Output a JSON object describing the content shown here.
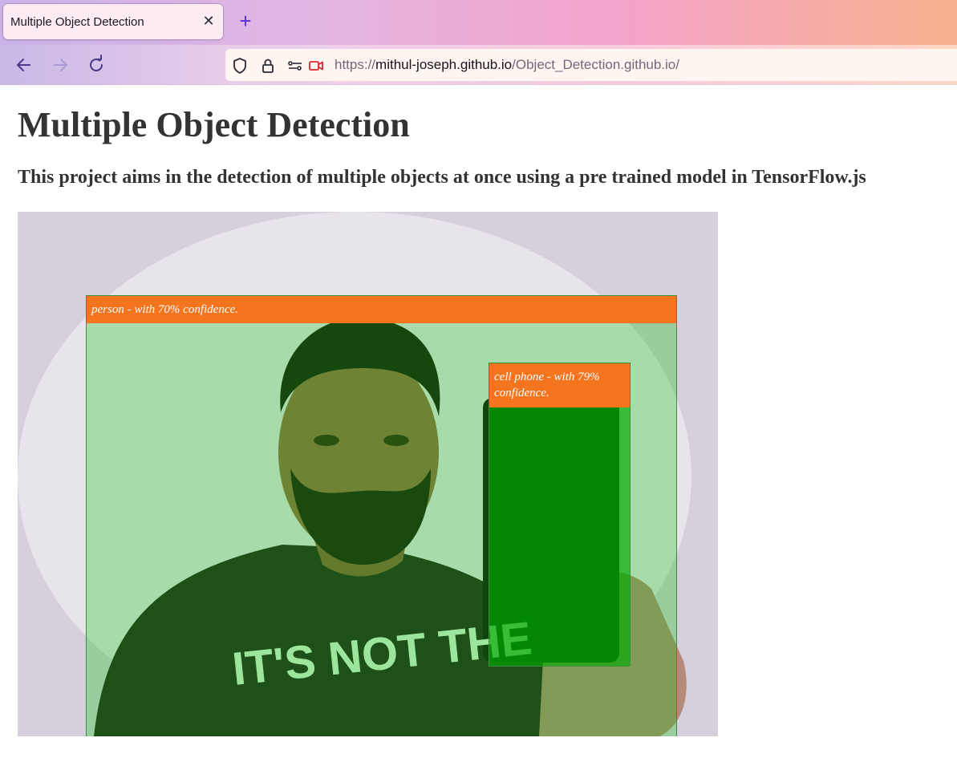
{
  "browser": {
    "tab_title": "Multiple Object Detection",
    "tab_close_icon": "close-icon",
    "new_tab_icon": "plus-icon",
    "back_icon": "arrow-left-icon",
    "forward_icon": "arrow-right-icon",
    "reload_icon": "reload-icon",
    "url_scheme": "https://",
    "url_host": "mithul-joseph.github.io",
    "url_path": "/Object_Detection.github.io/",
    "accent_color": "#5b2bd6"
  },
  "page": {
    "title": "Multiple Object Detection",
    "subtitle": "This project aims in the detection of multiple objects at once using a pre trained model in TensorFlow.js"
  },
  "detections": [
    {
      "label": "person - with 70% confidence.",
      "class": "person",
      "confidence": 70
    },
    {
      "label": "cell phone - with 79% confidence.",
      "class": "cell phone",
      "confidence": 79
    }
  ],
  "colors": {
    "label_bg": "#f5741e",
    "box_fill": "rgba(0,200,0,0.28)"
  }
}
